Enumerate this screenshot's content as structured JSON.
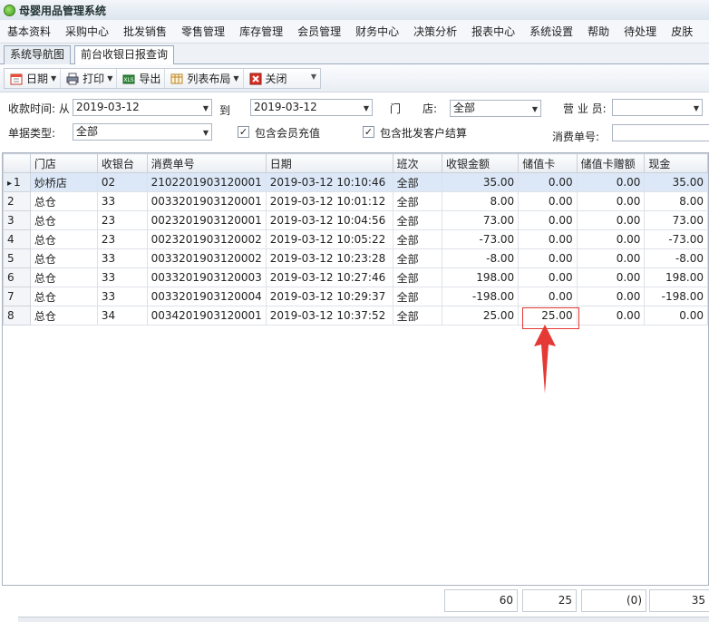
{
  "app": {
    "title": "母婴用品管理系统"
  },
  "menu": [
    "基本资料",
    "采购中心",
    "批发销售",
    "零售管理",
    "库存管理",
    "会员管理",
    "财务中心",
    "决策分析",
    "报表中心",
    "系统设置",
    "帮助",
    "待处理",
    "皮肤"
  ],
  "tabs": [
    "系统导航图",
    "前台收银日报查询"
  ],
  "toolbar": {
    "date": "日期",
    "print": "打印",
    "export": "导出",
    "layout": "列表布局",
    "close": "关闭"
  },
  "filters": {
    "pay_time_label": "收款时间: 从",
    "date_from": "2019-03-12",
    "to_label": "到",
    "date_to": "2019-03-12",
    "store_label": "门　　店:",
    "store_value": "全部",
    "clerk_label": "营 业 员:",
    "clerk_value": "",
    "doc_type_label": "单据类型:",
    "doc_type_value": "全部",
    "include_member_label": "包含会员充值",
    "include_wholesale_label": "包含批发客户结算",
    "consume_no_label": "消费单号:",
    "consume_no_value": ""
  },
  "columns": [
    "门店",
    "收银台",
    "消费单号",
    "日期",
    "班次",
    "收银金额",
    "储值卡",
    "储值卡赠额",
    "现金"
  ],
  "rows": [
    {
      "idx": "1",
      "store": "妙桥店",
      "till": "02",
      "no": "2102201903120001",
      "date": "2019-03-12 10:10:46",
      "shift": "全部",
      "amount": "35.00",
      "card": "0.00",
      "bonus": "0.00",
      "cash": "35.00"
    },
    {
      "idx": "2",
      "store": "总仓",
      "till": "33",
      "no": "0033201903120001",
      "date": "2019-03-12 10:01:12",
      "shift": "全部",
      "amount": "8.00",
      "card": "0.00",
      "bonus": "0.00",
      "cash": "8.00"
    },
    {
      "idx": "3",
      "store": "总仓",
      "till": "23",
      "no": "0023201903120001",
      "date": "2019-03-12 10:04:56",
      "shift": "全部",
      "amount": "73.00",
      "card": "0.00",
      "bonus": "0.00",
      "cash": "73.00"
    },
    {
      "idx": "4",
      "store": "总仓",
      "till": "23",
      "no": "0023201903120002",
      "date": "2019-03-12 10:05:22",
      "shift": "全部",
      "amount": "-73.00",
      "card": "0.00",
      "bonus": "0.00",
      "cash": "-73.00"
    },
    {
      "idx": "5",
      "store": "总仓",
      "till": "33",
      "no": "0033201903120002",
      "date": "2019-03-12 10:23:28",
      "shift": "全部",
      "amount": "-8.00",
      "card": "0.00",
      "bonus": "0.00",
      "cash": "-8.00"
    },
    {
      "idx": "6",
      "store": "总仓",
      "till": "33",
      "no": "0033201903120003",
      "date": "2019-03-12 10:27:46",
      "shift": "全部",
      "amount": "198.00",
      "card": "0.00",
      "bonus": "0.00",
      "cash": "198.00"
    },
    {
      "idx": "7",
      "store": "总仓",
      "till": "33",
      "no": "0033201903120004",
      "date": "2019-03-12 10:29:37",
      "shift": "全部",
      "amount": "-198.00",
      "card": "0.00",
      "bonus": "0.00",
      "cash": "-198.00"
    },
    {
      "idx": "8",
      "store": "总仓",
      "till": "34",
      "no": "0034201903120001",
      "date": "2019-03-12 10:37:52",
      "shift": "全部",
      "amount": "25.00",
      "card": "25.00",
      "bonus": "0.00",
      "cash": "0.00"
    }
  ],
  "totals": {
    "amount": "60",
    "card": "25",
    "bonus": "(0)",
    "cash": "35"
  },
  "colors": {
    "annotation": "#e53935",
    "selected_row": "#dce8f7"
  }
}
